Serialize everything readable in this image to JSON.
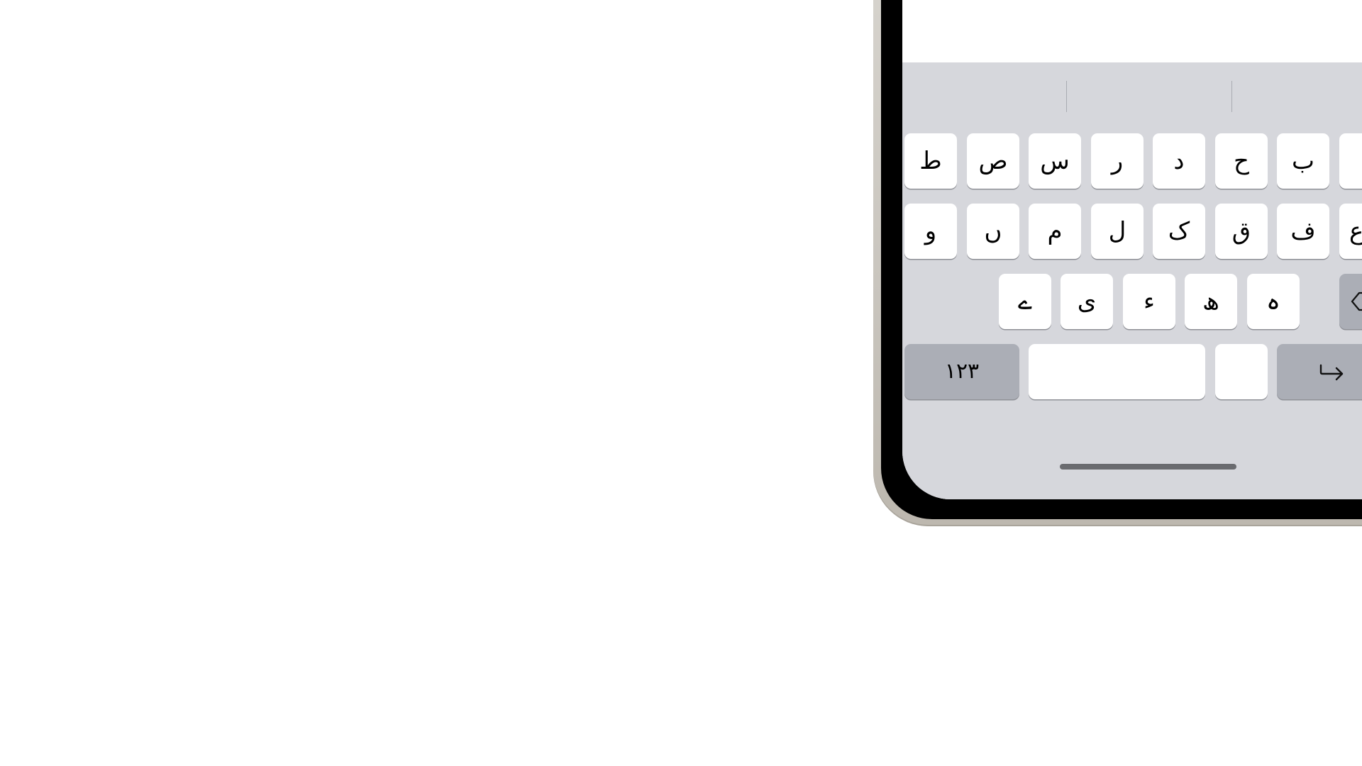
{
  "keyboard": {
    "row1": [
      "ط",
      "ص",
      "س",
      "ر",
      "د",
      "ح",
      "ب"
    ],
    "row2": [
      "و",
      "ں",
      "م",
      "ل",
      "ک",
      "ق",
      "ف"
    ],
    "row3": [
      "ے",
      "ی",
      "ء",
      "ھ",
      "ہ"
    ],
    "numbers_key_label": "۱۲۳",
    "space_label": "",
    "partial_key_row1": "",
    "partial_key_row2": "ع"
  },
  "colors": {
    "keyboard_bg": "#d6d7dc",
    "key_light": "#ffffff",
    "key_dark": "#abaeb6",
    "frame": "#d9d6d0"
  },
  "icons": {
    "delete": "delete-backspace-icon",
    "return": "return-arrow-icon"
  }
}
